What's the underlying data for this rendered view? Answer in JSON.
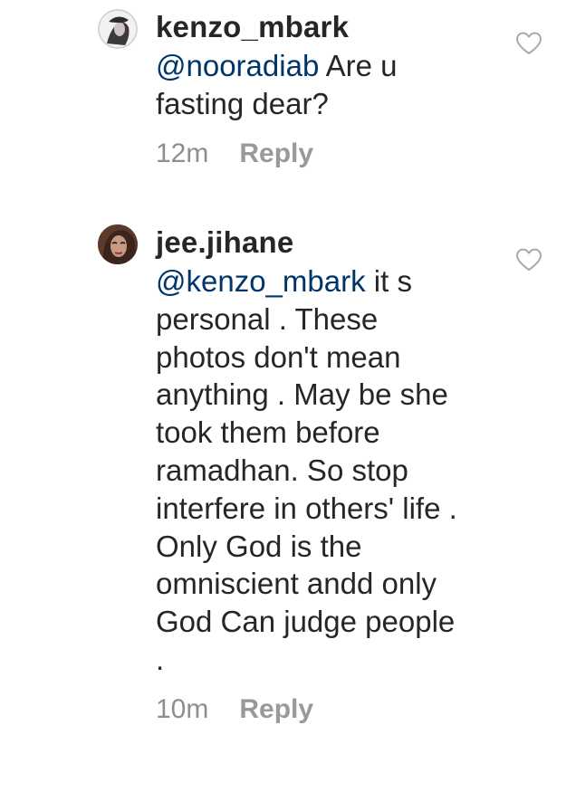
{
  "comments": [
    {
      "username": "kenzo_mbark",
      "mention": "@nooradiab",
      "text": " Are u fasting dear?",
      "time": "12m",
      "reply_label": "Reply",
      "avatar_icon": "user-avatar-photo",
      "like_icon": "heart-outline-icon"
    },
    {
      "username": "jee.jihane",
      "mention": "@kenzo_mbark",
      "text": " it s personal . These photos don't mean anything . May be she took them before ramadhan. So stop interfere in others' life . Only God is the omniscient andd only God Can judge people .",
      "time": "10m",
      "reply_label": "Reply",
      "avatar_icon": "user-avatar-photo",
      "like_icon": "heart-outline-icon"
    }
  ],
  "colors": {
    "username": "#262626",
    "mention": "#003569",
    "meta": "#8e8e8e",
    "heart_stroke": "#a8a8a8"
  }
}
